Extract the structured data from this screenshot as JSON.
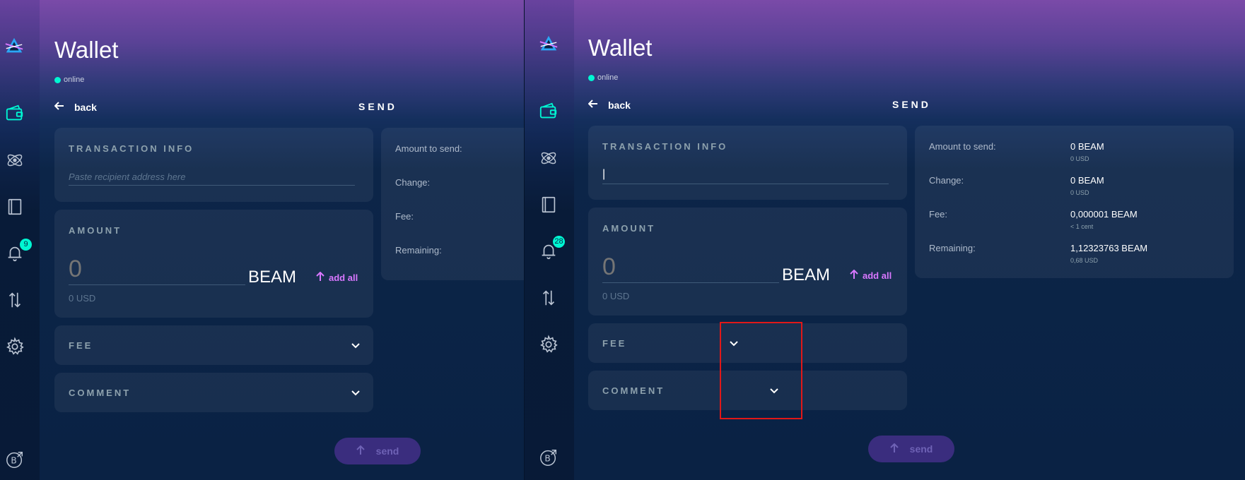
{
  "left": {
    "title": "Wallet",
    "status": "online",
    "back_label": "back",
    "heading": "SEND",
    "notifications_count": "9",
    "transaction_info_label": "TRANSACTION INFO",
    "address_placeholder": "Paste recipient address here",
    "amount_label": "AMOUNT",
    "amount_placeholder": "0",
    "currency": "BEAM",
    "add_all_label": "add all",
    "usd_value": "0 USD",
    "fee_label": "FEE",
    "comment_label": "COMMENT",
    "summary": {
      "amount_label": "Amount to send:",
      "change_label": "Change:",
      "fee_label": "Fee:",
      "remaining_label": "Remaining:"
    },
    "send_label": "send"
  },
  "right": {
    "title": "Wallet",
    "status": "online",
    "back_label": "back",
    "heading": "SEND",
    "notifications_count": "28",
    "transaction_info_label": "TRANSACTION INFO",
    "address_value": "|",
    "amount_label": "AMOUNT",
    "amount_placeholder": "0",
    "currency": "BEAM",
    "add_all_label": "add all",
    "usd_value": "0 USD",
    "fee_label": "FEE",
    "comment_label": "COMMENT",
    "summary": {
      "amount_label": "Amount to send:",
      "amount_value": "0 BEAM",
      "amount_usd": "0 USD",
      "change_label": "Change:",
      "change_value": "0 BEAM",
      "change_usd": "0 USD",
      "fee_label": "Fee:",
      "fee_value": "0,000001 BEAM",
      "fee_usd": "< 1 cent",
      "remaining_label": "Remaining:",
      "remaining_value": "1,12323763 BEAM",
      "remaining_usd": "0,68 USD"
    },
    "send_label": "send"
  },
  "icons": {
    "logo": "beam-logo-icon",
    "wallet": "wallet-icon",
    "atomic_swap": "atom-icon",
    "addresses": "address-book-icon",
    "notifications": "bell-icon",
    "transactions": "transfer-arrows-icon",
    "settings": "gear-icon",
    "dapps": "beam-external-icon"
  },
  "colors": {
    "accent": "#00f6d2",
    "amount": "#d977ff",
    "highlight": "#e01818"
  }
}
